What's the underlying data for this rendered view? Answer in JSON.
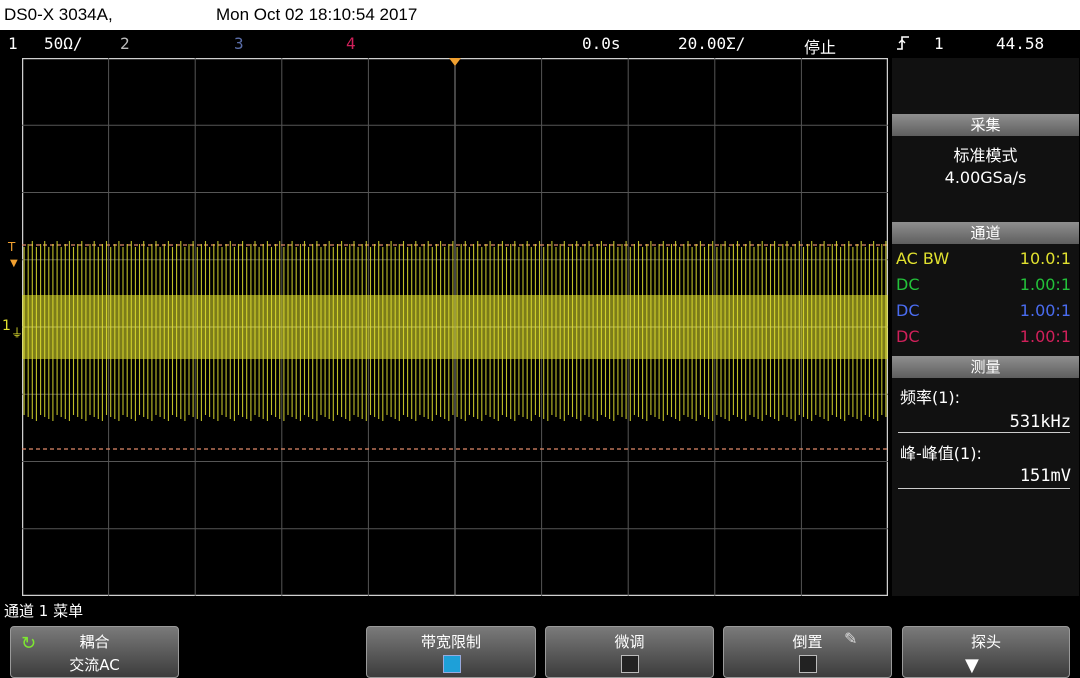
{
  "topbar": {
    "model": "DS0-X 3034A,",
    "datetime": "Mon Oct 02 18:10:54 2017"
  },
  "channel_bar": {
    "ch1_num": "1",
    "ch1_scale": "50Ω/",
    "ch2_num": "2",
    "ch3_num": "3",
    "ch4_num": "4",
    "time_delay": "0.0s",
    "time_scale": "20.00Σ/",
    "run_state": "停止",
    "trigger_icon": "trigger-edge-icon",
    "trigger_channel": "1",
    "trigger_level": "44.58"
  },
  "markers": {
    "trigger_T": "T",
    "ch1_ground": "1"
  },
  "acquisition": {
    "title": "采集",
    "mode": "标准模式",
    "sample_rate": "4.00GSa/s"
  },
  "channels": {
    "title": "通道",
    "items": [
      {
        "coupling": "AC BW",
        "probe": "10.0:1",
        "color": "#e1e12f"
      },
      {
        "coupling": "DC",
        "probe": "1.00:1",
        "color": "#23c23a"
      },
      {
        "coupling": "DC",
        "probe": "1.00:1",
        "color": "#4a6cf0"
      },
      {
        "coupling": "DC",
        "probe": "1.00:1",
        "color": "#d0205a"
      }
    ]
  },
  "measure": {
    "title": "测量",
    "m1_label": "频率(1):",
    "m1_value": "531kHz",
    "m2_label": "峰-峰值(1):",
    "m2_value": "151mV"
  },
  "softkeys": {
    "menu_title": "通道 1 菜单",
    "coupling_title": "耦合",
    "coupling_value": "交流AC",
    "bw_limit": "带宽限制",
    "fine": "微调",
    "invert": "倒置",
    "probe": "探头"
  }
}
